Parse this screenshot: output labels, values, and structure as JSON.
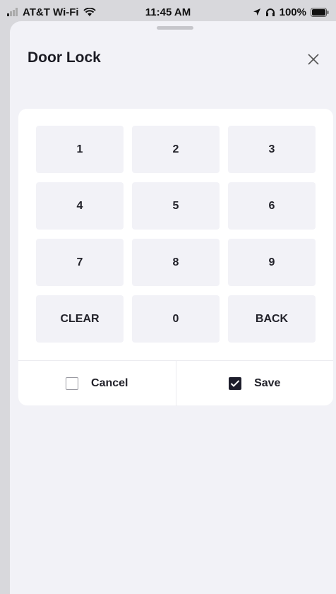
{
  "status_bar": {
    "carrier": "AT&T Wi-Fi",
    "time": "11:45 AM",
    "battery": "100%"
  },
  "sheet": {
    "title": "Door Lock",
    "close_icon": "close-icon"
  },
  "keypad": {
    "keys": [
      "1",
      "2",
      "3",
      "4",
      "5",
      "6",
      "7",
      "8",
      "9",
      "CLEAR",
      "0",
      "BACK"
    ]
  },
  "actions": {
    "cancel_label": "Cancel",
    "cancel_checked": false,
    "save_label": "Save",
    "save_checked": true
  },
  "colors": {
    "sheet_background": "#f2f2f7",
    "key_background": "#f2f2f7",
    "text": "#22222a",
    "checked_box": "#1e1e2c"
  }
}
